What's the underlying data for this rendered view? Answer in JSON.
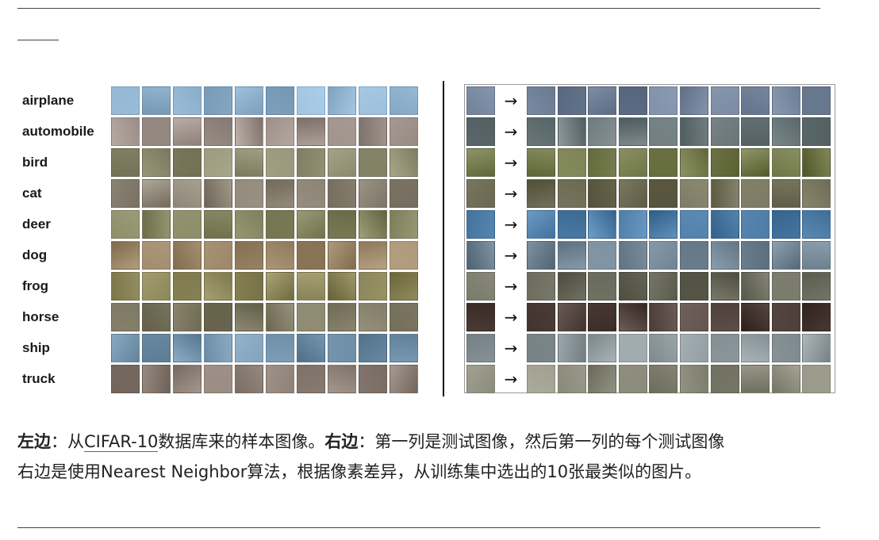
{
  "left_figure": {
    "classes": [
      "airplane",
      "automobile",
      "bird",
      "cat",
      "deer",
      "dog",
      "frog",
      "horse",
      "ship",
      "truck"
    ],
    "row_tints": [
      "#8fb2cf",
      "#9b8f88",
      "#8c8a6e",
      "#8e8677",
      "#7e7f5a",
      "#a08a6c",
      "#8a8558",
      "#7f7a63",
      "#6f8fa8",
      "#8a7d73"
    ]
  },
  "right_figure": {
    "arrow": "→",
    "row_tints": [
      "#6e7f96",
      "#6d7a7d",
      "#6f7648",
      "#6f6c55",
      "#4f7ea8",
      "#6f8291",
      "#6a6b5c",
      "#4f3f3a",
      "#8f9a9f",
      "#8a8a7a"
    ]
  },
  "caption": {
    "left_label": "左边",
    "colon1": "：从",
    "dataset": "CIFAR-10",
    "part1": "数据库来的样本图像。",
    "right_label": "右边",
    "colon2": "：第一列是测试图像，然后第一列的每个测试图像",
    "line2": "右边是使用Nearest Neighbor算法，根据像素差异，从训练集中选出的10张最类似的图片。"
  }
}
